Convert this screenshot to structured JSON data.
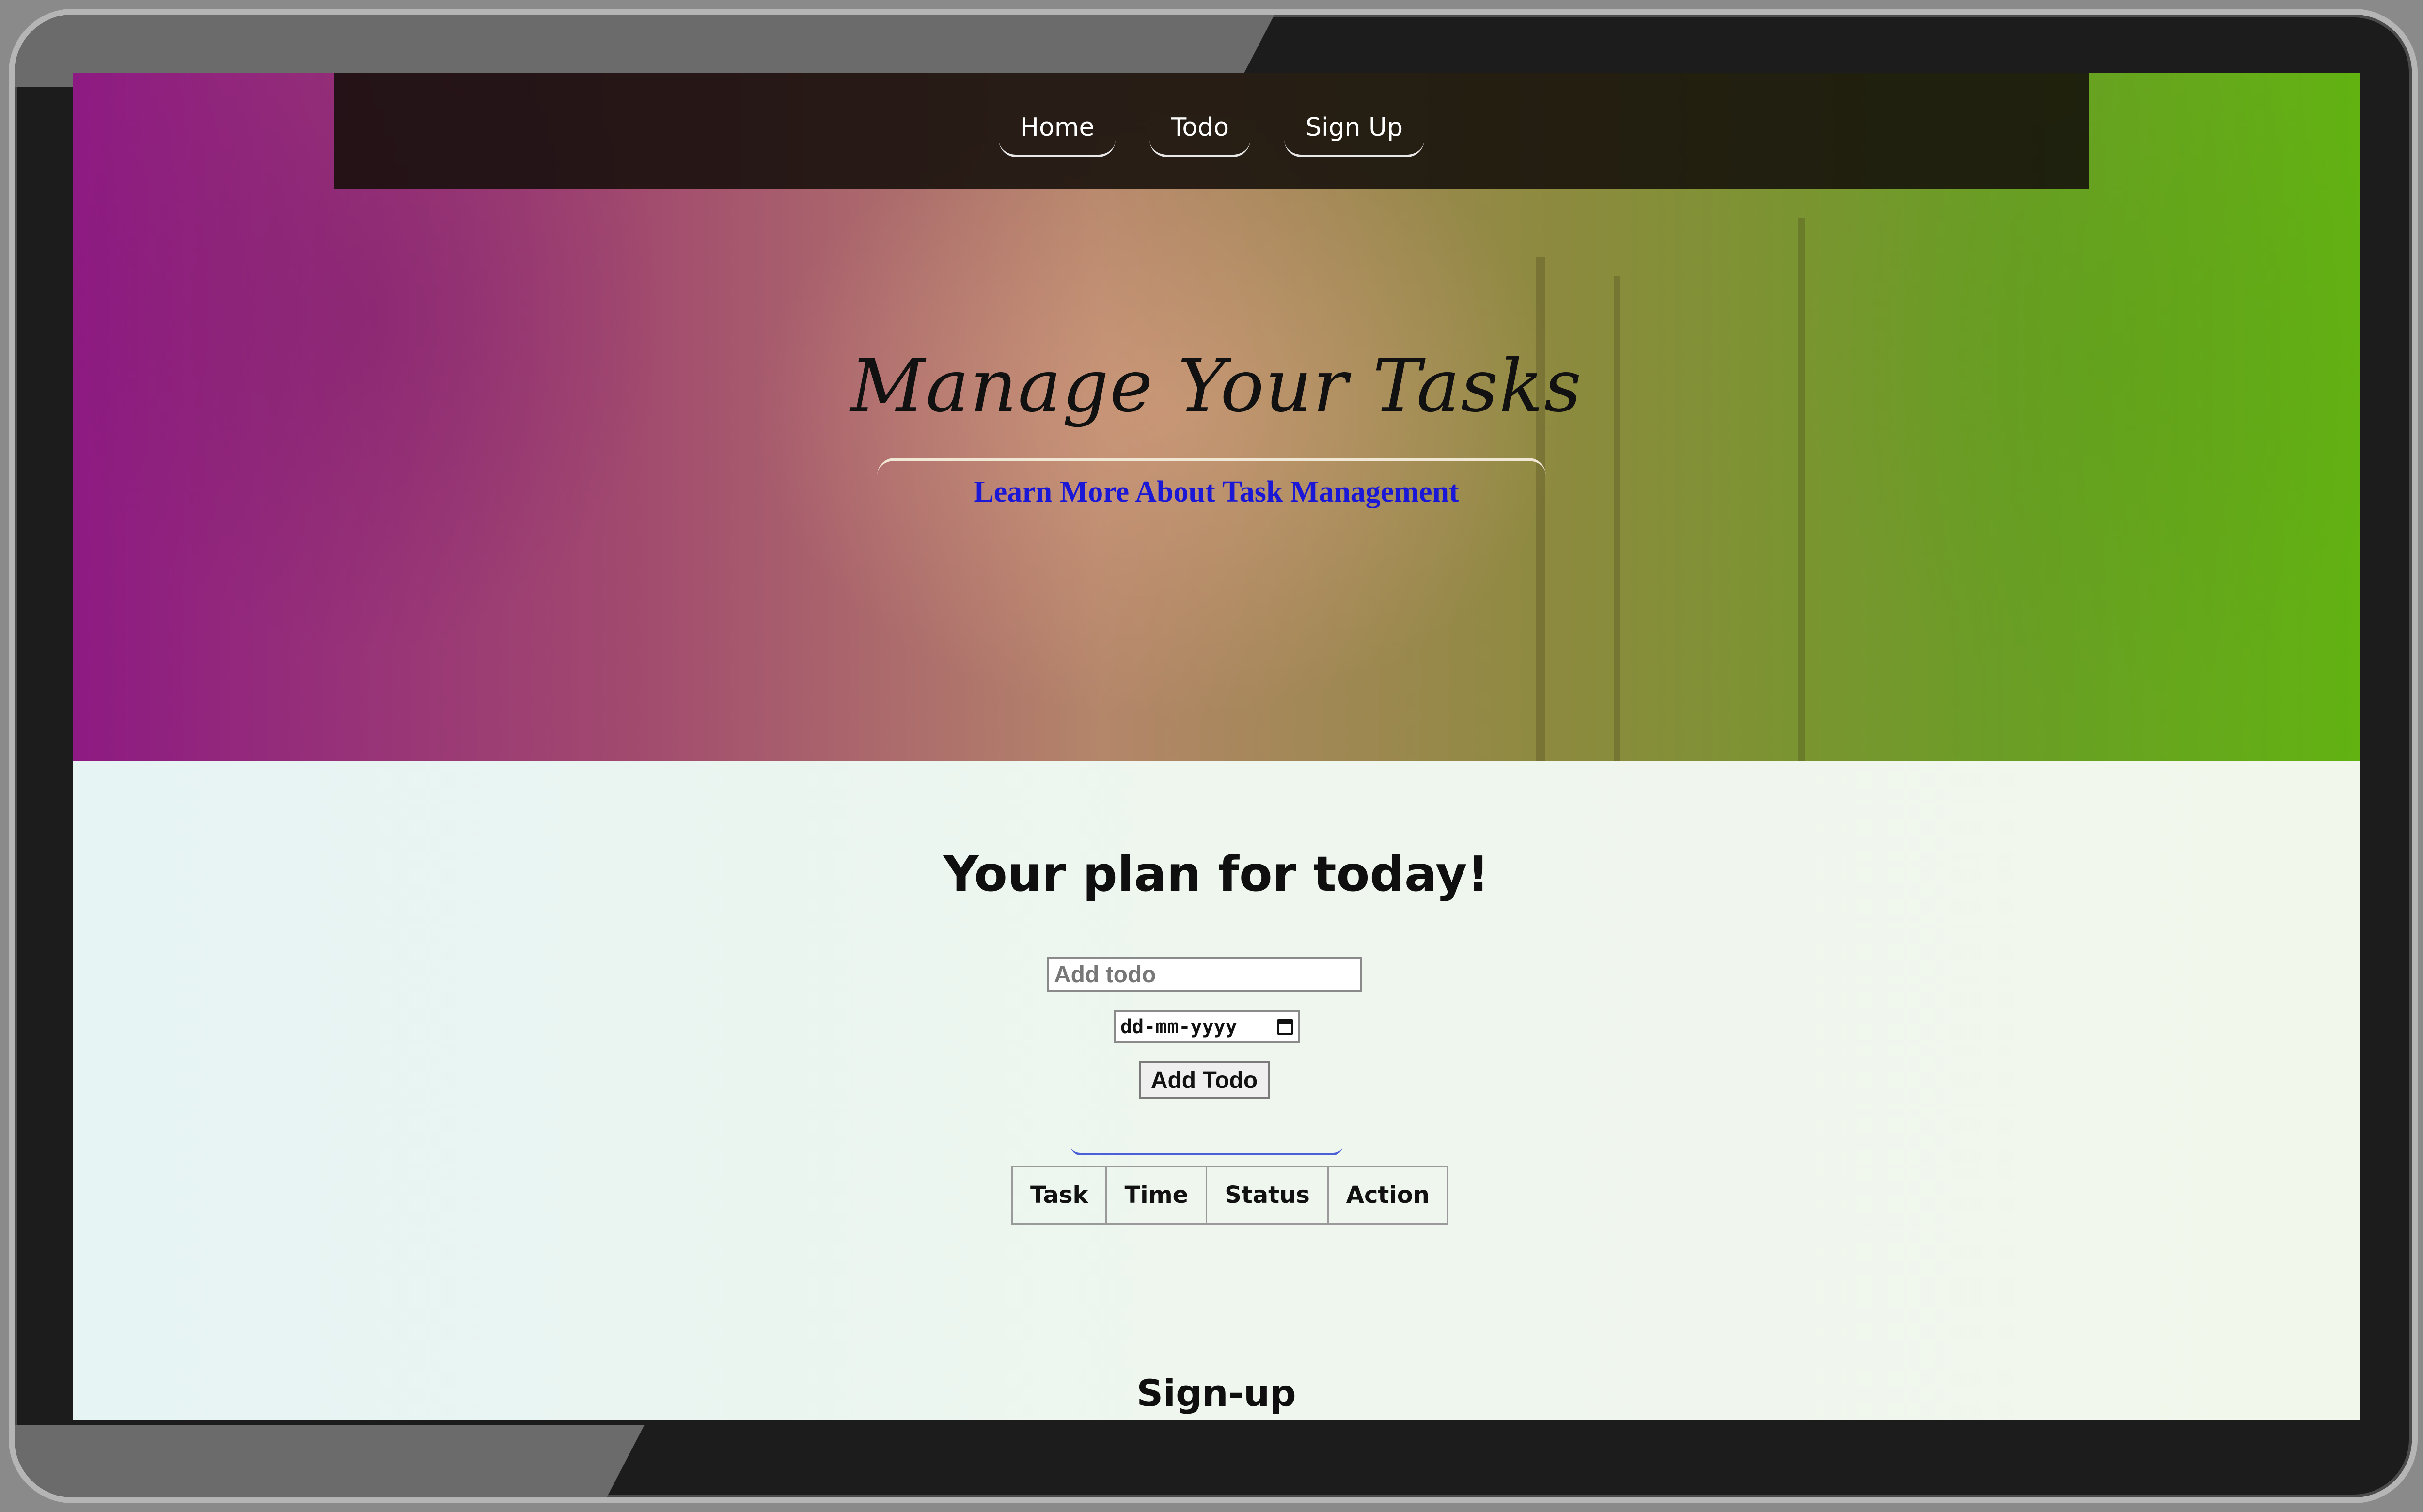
{
  "nav": {
    "items": [
      {
        "label": "Home"
      },
      {
        "label": "Todo"
      },
      {
        "label": "Sign Up"
      }
    ]
  },
  "hero": {
    "title": "Manage Your Tasks",
    "link_text": "Learn More About Task Management"
  },
  "todo": {
    "heading": "Your plan for today!",
    "input_placeholder": "Add todo",
    "date_placeholder": "dd-mm-yyyy",
    "add_button_label": "Add Todo",
    "table_headers": [
      "Task",
      "Time",
      "Status",
      "Action"
    ]
  },
  "signup": {
    "heading": "Sign-up"
  },
  "colors": {
    "hero_left": "#8d1a82",
    "hero_right": "#62b212",
    "link_blue": "#1a17d6",
    "navbar_bg": "#140f0a"
  }
}
